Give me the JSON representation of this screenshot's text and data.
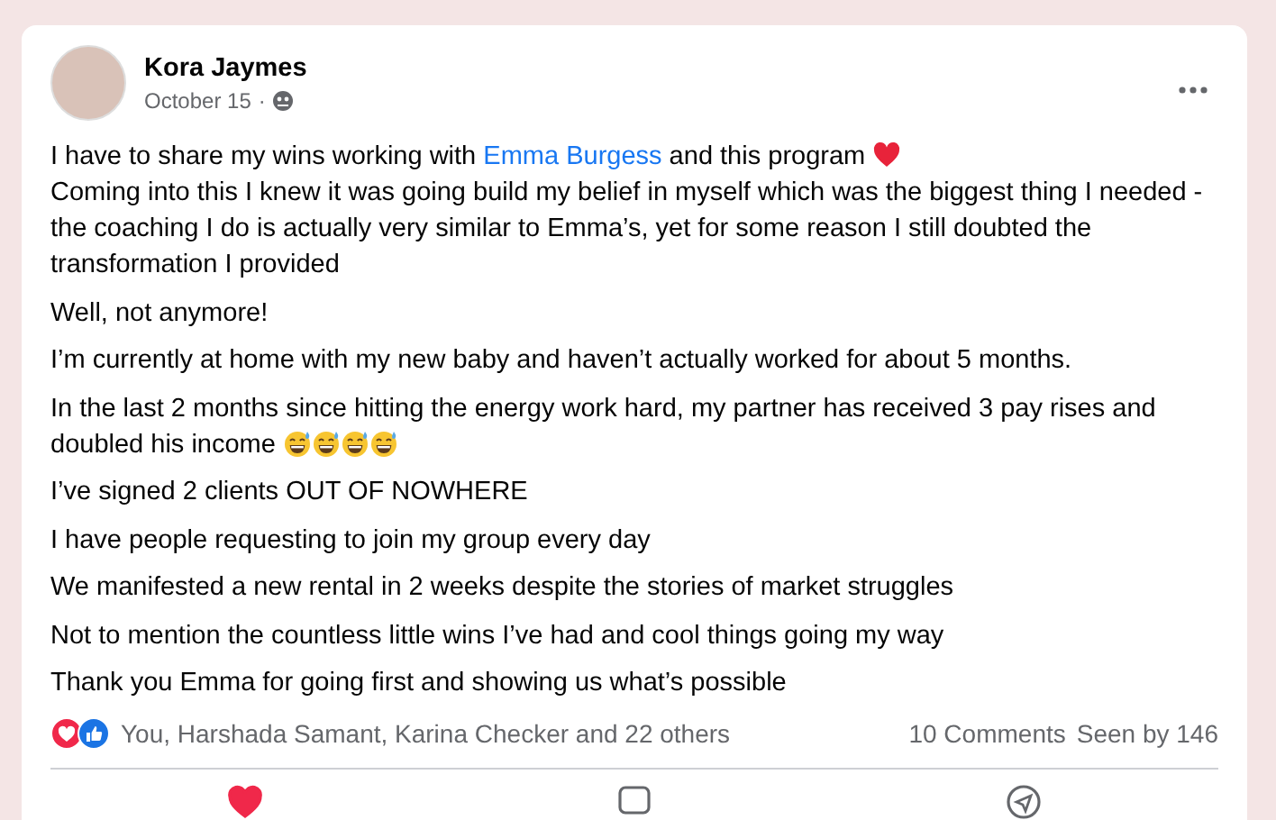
{
  "post": {
    "author": "Kora Jaymes",
    "date": "October 15",
    "separator": "·",
    "paragraphs": [
      {
        "segments": [
          {
            "kind": "text",
            "text": "I have to share my wins working with "
          },
          {
            "kind": "mention",
            "text": "Emma Burgess"
          },
          {
            "kind": "text",
            "text": " and this program "
          },
          {
            "kind": "heart-emoji"
          },
          {
            "kind": "break"
          },
          {
            "kind": "text",
            "text": "Coming into this I knew it was going build my belief in myself which was the biggest thing I needed - the coaching I do is actually very similar to Emma’s, yet for some reason I still doubted the transformation I provided"
          }
        ]
      },
      {
        "segments": [
          {
            "kind": "text",
            "text": "Well, not anymore!"
          }
        ]
      },
      {
        "segments": [
          {
            "kind": "text",
            "text": "I’m currently at home with my new baby and haven’t actually worked for about 5 months."
          }
        ]
      },
      {
        "segments": [
          {
            "kind": "text",
            "text": "In the last 2 months since hitting the energy work hard, my partner has received 3 pay rises and doubled his income "
          },
          {
            "kind": "grin-sweat-emoji"
          },
          {
            "kind": "grin-sweat-emoji"
          },
          {
            "kind": "grin-sweat-emoji"
          },
          {
            "kind": "grin-sweat-emoji"
          }
        ]
      },
      {
        "segments": [
          {
            "kind": "text",
            "text": "I’ve signed 2 clients OUT OF NOWHERE"
          }
        ]
      },
      {
        "segments": [
          {
            "kind": "text",
            "text": "I have people requesting to join my group every day"
          }
        ]
      },
      {
        "segments": [
          {
            "kind": "text",
            "text": "We manifested a new rental in 2 weeks despite the stories of market struggles"
          }
        ]
      },
      {
        "segments": [
          {
            "kind": "text",
            "text": "Not to mention the countless little wins I’ve had and cool things going my way"
          }
        ]
      },
      {
        "segments": [
          {
            "kind": "text",
            "text": "Thank you Emma for going first and showing us what’s possible"
          }
        ]
      }
    ],
    "reactions": [
      {
        "kind": "love"
      },
      {
        "kind": "like"
      }
    ],
    "reaction_summary": "You, Harshada Samant, Karina Checker and 22 others",
    "comments": "10 Comments",
    "seen": "Seen by 146",
    "actions": [
      {
        "kind": "love",
        "active": true
      },
      {
        "kind": "comment",
        "active": false
      },
      {
        "kind": "send",
        "active": false
      }
    ]
  }
}
